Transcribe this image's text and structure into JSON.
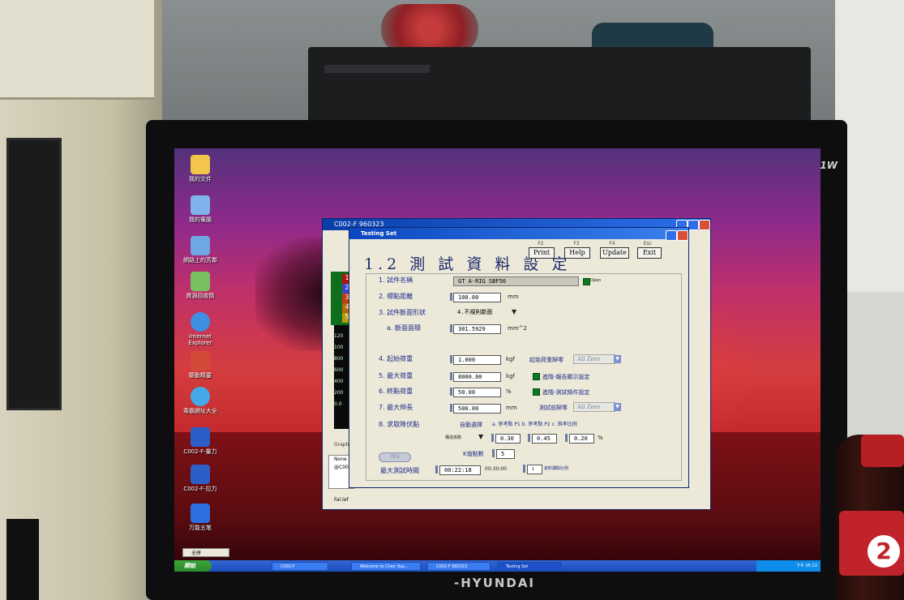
{
  "monitor": {
    "brand": "-HYUNDAI",
    "model": "N91W"
  },
  "desktop_icons": [
    {
      "label": "我的文件",
      "icon": "folder-icon",
      "color": "#f3c54a"
    },
    {
      "label": "我的電腦",
      "icon": "computer-icon",
      "color": "#7fb2ec"
    },
    {
      "label": "網路上的芳鄰",
      "icon": "network-icon",
      "color": "#6fa7e4"
    },
    {
      "label": "資源回收筒",
      "icon": "recycle-bin-icon",
      "color": "#79c060"
    },
    {
      "label": "Internet Explorer",
      "icon": "ie-icon",
      "color": "#3e8ee4"
    },
    {
      "label": "驅動精靈",
      "icon": "driver-icon",
      "color": "#d34a3a"
    },
    {
      "label": "毒霸網址大全",
      "icon": "ie-icon",
      "color": "#43a9e8"
    },
    {
      "label": "C002-F-量力",
      "icon": "app-icon",
      "color": "#2c5ec8"
    },
    {
      "label": "C002-F-拉力",
      "icon": "app-icon",
      "color": "#2c5ec8"
    },
    {
      "label": "万能五笔",
      "icon": "ime-app-icon",
      "color": "#2d6ee0"
    }
  ],
  "background_window": {
    "title": "C002-F 960323",
    "legend_numbers": [
      "1",
      "2",
      "3",
      "4",
      "5"
    ],
    "graph_labels": [
      "120",
      "100",
      "800",
      "600",
      "400",
      "200",
      "0.0"
    ],
    "graph_caption": "Graph",
    "bottom_labels": [
      "None",
      "@C002"
    ],
    "footer": "Fal.lef"
  },
  "dialog": {
    "title": "Testing Set",
    "header": "1.2 測 試 資 料 設 定",
    "fkeys": [
      "F2",
      "F3",
      "F4",
      "Esc"
    ],
    "buttons": {
      "print": "Print",
      "help": "Help",
      "update": "Update",
      "exit": "Exit"
    },
    "fields": {
      "specimen_name_label": "1. 試件名稱",
      "specimen_name_value": "GT A-RIG SBF50",
      "open_label": "Open",
      "gauge_length_label": "2. 標點距離",
      "gauge_length_value": "100.00",
      "gauge_length_unit": "mm",
      "shape_label": "3. 試件斷面形狀",
      "shape_value": "4.不規則斷面",
      "area_label": "a. 斷面面積",
      "area_value": "301.5929",
      "area_unit": "mm^2",
      "initial_load_label": "4. 起始荷重",
      "initial_load_value": "1.000",
      "initial_load_unit": "kgf",
      "initial_zero_label": "起始荷重歸零",
      "initial_zero_value": "All Zero",
      "max_load_label": "5. 最大荷重",
      "max_load_value": "8000.00",
      "max_load_unit": "kgf",
      "advanced_display_label": "進階-報告顯示設定",
      "end_load_label": "6. 終點荷重",
      "end_load_value": "50.00",
      "end_load_unit": "%",
      "advanced_test_label": "進階-測試條件設定",
      "max_elong_label": "7. 最大伸長",
      "max_elong_value": "500.00",
      "max_elong_unit": "mm",
      "test_zero_label": "測試前歸零",
      "test_zero_value": "All Zero",
      "yield_label": "8. 求取降伏點",
      "yield_button": "YES",
      "method_label": "自動選擇",
      "ref_label": "a. 參考點 P1  b. 參考點 P2  c. 斜率比例",
      "method_value": "構造係數",
      "ref_a": "0.30",
      "ref_b": "0.45",
      "ref_c": "0.20",
      "ref_unit": "%",
      "k_label": "K值點數",
      "k_value": "5",
      "max_time_label": "最大測試時間",
      "max_time_value": "00:22:18",
      "max_time_unit": "00:30:00",
      "pct_value": "1",
      "pct_label": "資料讀取比例"
    }
  },
  "taskbar": {
    "start": "開始",
    "ime": "全拼",
    "tasks": [
      "C002-F",
      "Welcome to Chen Yua...",
      "C002-F 960323",
      "Testing Set"
    ],
    "clock": "下午 05:22"
  }
}
